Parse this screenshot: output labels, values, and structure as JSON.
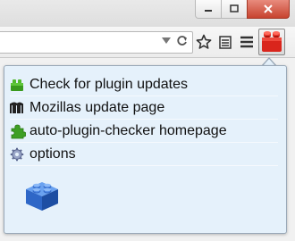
{
  "menu": {
    "items": [
      {
        "label": "Check for plugin updates",
        "icon": "green-puzzle-icon"
      },
      {
        "label": "Mozillas update page",
        "icon": "mozilla-m-icon"
      },
      {
        "label": "auto-plugin-checker homepage",
        "icon": "green-puzzle-piece-icon"
      },
      {
        "label": "options",
        "icon": "gear-icon"
      }
    ]
  },
  "colors": {
    "panel_bg": "#e5f1fb",
    "addon_red": "#d9251c",
    "lego_blue": "#2f6fd1",
    "close_red": "#c7432f"
  }
}
